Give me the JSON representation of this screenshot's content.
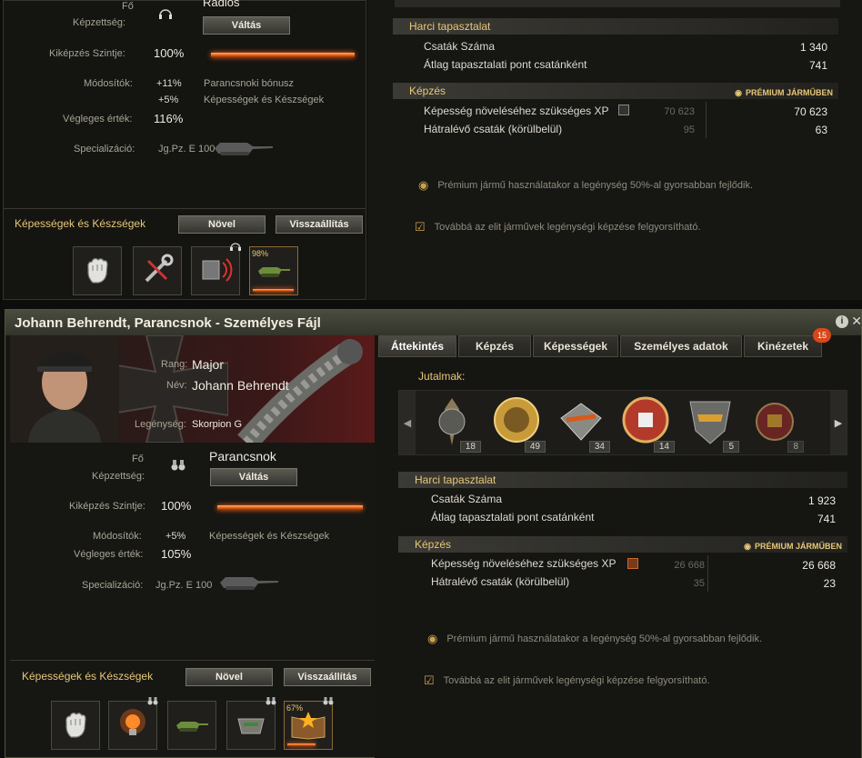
{
  "top": {
    "radio_header": "Rádiós",
    "main_qual_label": "Fő Képzettség:",
    "switch_button": "Váltás",
    "training_label": "Kiképzés Szintje:",
    "training_value": "100%",
    "training_fill": 1.0,
    "modifiers_label": "Módosítók:",
    "modifiers": [
      {
        "value": "+11%",
        "desc": "Parancsnoki bónusz"
      },
      {
        "value": "+5%",
        "desc": "Képességek és Készségek"
      }
    ],
    "final_label": "Végleges érték:",
    "final_value": "116%",
    "spec_label": "Specializáció:",
    "spec_value": "Jg.Pz. E 100",
    "skills_header": "Képességek és Készségek",
    "increase_button": "Növel",
    "reset_button": "Visszaállítás",
    "skill_progress": "98%",
    "skill_fill": 0.98,
    "stats": {
      "combat_header": "Harci tapasztalat",
      "battles_label": "Csaták Száma",
      "battles_value": "1 340",
      "avg_label": "Átlag tapasztalati pont csatánként",
      "avg_value": "741",
      "training_header": "Képzés",
      "premium_label": "PRÉMIUM JÁRMŰBEN",
      "xp_label": "Képesség növeléséhez szükséges XP",
      "xp_normal": "70 623",
      "xp_premium": "70 623",
      "remaining_label": "Hátralévő csaták (körülbelül)",
      "remaining_normal": "95",
      "remaining_premium": "63",
      "note1": "Prémium jármű használatakor a legénység 50%-al gyorsabban fejlődik.",
      "note2": "Továbbá az elit járművek legénységi képzése felgyorsítható."
    }
  },
  "window": {
    "title": "Johann Behrendt, Parancsnok - Személyes Fájl",
    "rank_label": "Rang:",
    "rank_value": "Major",
    "name_label": "Név:",
    "name_value": "Johann Behrendt",
    "crew_label": "Legénység:",
    "crew_value": "Skorpion G",
    "main_qual_label1": "Fő",
    "main_qual_label2": "Képzettség:",
    "main_qual_value": "Parancsnok",
    "switch_button": "Váltás",
    "training_label": "Kiképzés Szintje:",
    "training_value": "100%",
    "training_fill": 1.0,
    "modifiers_label": "Módosítók:",
    "modifier_value": "+5%",
    "modifier_desc": "Képességek és Készségek",
    "final_label": "Végleges érték:",
    "final_value": "105%",
    "spec_label": "Specializáció:",
    "spec_value": "Jg.Pz. E 100",
    "skills_header": "Képességek és Készségek",
    "increase_button": "Növel",
    "reset_button": "Visszaállítás",
    "skill_progress": "67%",
    "skill_fill": 0.67,
    "tabs": [
      "Áttekintés",
      "Képzés",
      "Képességek",
      "Személyes adatok",
      "Kinézetek"
    ],
    "tab_badge": "15",
    "awards_label": "Jutalmak:",
    "medals": [
      "18",
      "49",
      "34",
      "14",
      "5",
      "8"
    ],
    "stats": {
      "combat_header": "Harci tapasztalat",
      "battles_label": "Csaták Száma",
      "battles_value": "1 923",
      "avg_label": "Átlag tapasztalati pont csatánként",
      "avg_value": "741",
      "training_header": "Képzés",
      "premium_label": "PRÉMIUM JÁRMŰBEN",
      "xp_label": "Képesség növeléséhez szükséges XP",
      "xp_normal": "26 668",
      "xp_premium": "26 668",
      "remaining_label": "Hátralévő csaták (körülbelül)",
      "remaining_normal": "35",
      "remaining_premium": "23",
      "note1": "Prémium jármű használatakor a legénység 50%-al gyorsabban fejlődik.",
      "note2": "Továbbá az elit járművek legénységi képzése felgyorsítható."
    }
  },
  "colors": {
    "accent": "#e8c878",
    "bar": "#e05a10",
    "badge": "#d9461a"
  }
}
